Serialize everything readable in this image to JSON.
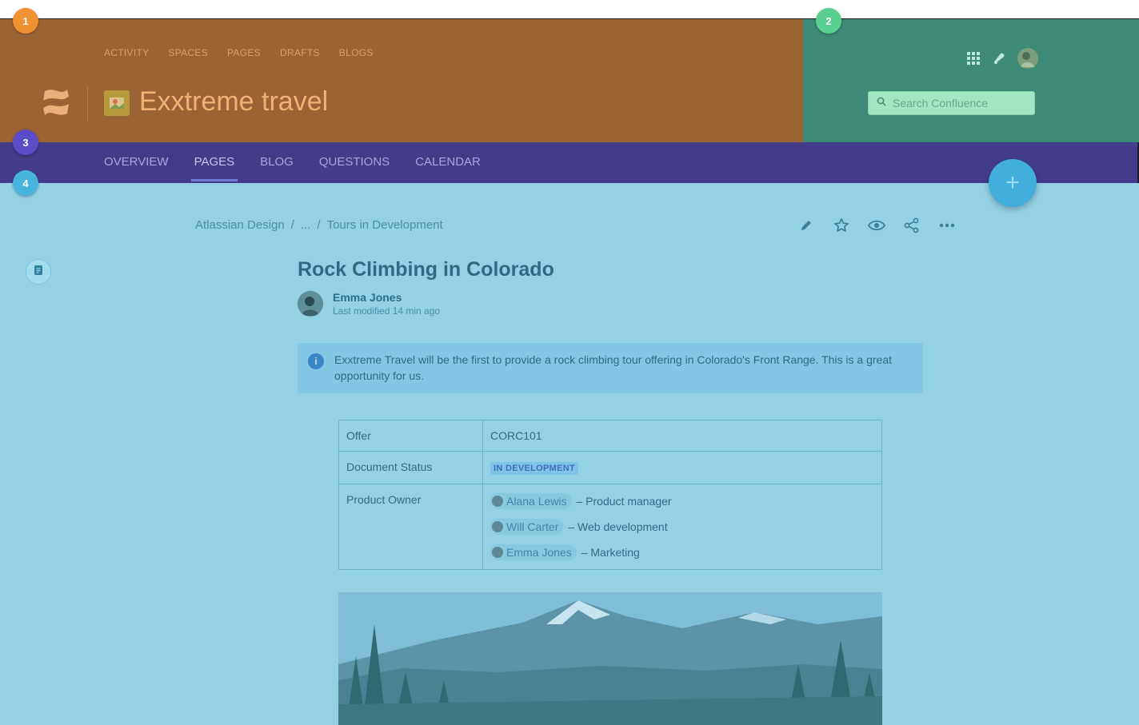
{
  "topnav": [
    "ACTIVITY",
    "SPACES",
    "PAGES",
    "DRAFTS",
    "BLOGS"
  ],
  "space": {
    "title": "Exxtreme travel"
  },
  "search": {
    "placeholder": "Search Confluence"
  },
  "header_icons": [
    "apps-grid-icon",
    "notification-bell-icon",
    "user-avatar"
  ],
  "tabs": [
    {
      "label": "OVERVIEW",
      "active": false
    },
    {
      "label": "PAGES",
      "active": true
    },
    {
      "label": "BLOG",
      "active": false
    },
    {
      "label": "QUESTIONS",
      "active": false
    },
    {
      "label": "CALENDAR",
      "active": false
    }
  ],
  "badges": [
    "1",
    "2",
    "3",
    "4"
  ],
  "fab": {
    "label": "+"
  },
  "breadcrumb": [
    "Atlassian Design",
    "...",
    "Tours in Development"
  ],
  "breadcrumb_separator": "/",
  "page_actions": [
    "edit-icon",
    "star-icon",
    "watch-icon",
    "share-icon",
    "more-icon"
  ],
  "page": {
    "title": "Rock Climbing in Colorado",
    "author": "Emma Jones",
    "modified": "Last modified 14 min ago"
  },
  "info_panel": {
    "icon": "i",
    "text": "Exxtreme Travel will be the first to provide a rock climbing tour offering in Colorado's Front Range. This is a great opportunity for us."
  },
  "properties": {
    "offer_label": "Offer",
    "offer_value": "CORC101",
    "status_label": "Document Status",
    "status_value": "IN DEVELOPMENT",
    "owner_label": "Product Owner",
    "owners": [
      {
        "name": "Alana Lewis",
        "role": "– Product manager"
      },
      {
        "name": "Will Carter",
        "role": "– Web development"
      },
      {
        "name": "Emma Jones",
        "role": "– Marketing"
      }
    ]
  },
  "colors": {
    "header_overlay": "#9a6435",
    "header_right_overlay": "#3d8a76",
    "nav_overlay": "#433c8a",
    "content_overlay": "#94d1e5",
    "badge_1": "#f29132",
    "badge_2": "#59cf8f",
    "badge_3": "#5b4cc8",
    "badge_4": "#48b3dc"
  }
}
